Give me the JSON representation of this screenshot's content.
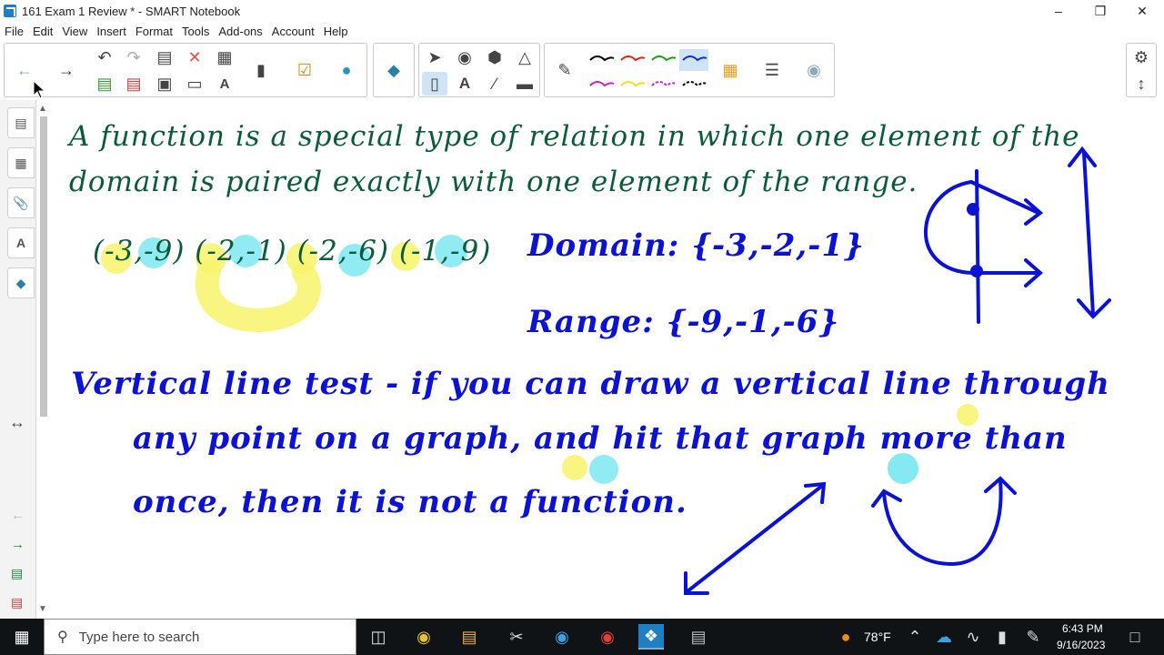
{
  "window": {
    "title": "161 Exam 1 Review * - SMART Notebook",
    "minimize": "–",
    "restore": "❐",
    "close": "✕"
  },
  "menu": [
    "File",
    "Edit",
    "View",
    "Insert",
    "Format",
    "Tools",
    "Add-ons",
    "Account",
    "Help"
  ],
  "board": {
    "definition_line1": "A function is a special type of relation in which one element of the",
    "definition_line2": "domain is paired exactly with one element of the range.",
    "pairs": "(-3,-9) (-2,-1) (-2,-6) (-1,-9)",
    "domain": "Domain: {-3,-2,-1}",
    "range": "Range: {-9,-1,-6}",
    "vlt_line1": "Vertical line test - if you can draw a vertical line through",
    "vlt_line2": "any point on a graph, and hit that graph more than",
    "vlt_line3": "once, then it is not a function."
  },
  "taskbar": {
    "search_placeholder": "Type here to search",
    "weather": "78°F",
    "time": "6:43 PM",
    "date": "9/16/2023"
  },
  "colors": {
    "ink_green": "#0b5b3a",
    "ink_blue": "#0c12d4",
    "highlight_yellow": "#f7f36a",
    "highlight_cyan": "#7ee8f0",
    "taskbar_bg": "#0f1316"
  },
  "icons": {
    "back": "arrow-left-icon",
    "forward": "arrow-right-icon",
    "undo": "undo-icon",
    "redo": "redo-icon",
    "delete": "x-delete-icon",
    "table": "table-icon",
    "select": "cursor-icon",
    "pen": "pen-icon",
    "settings": "gear-icon"
  }
}
